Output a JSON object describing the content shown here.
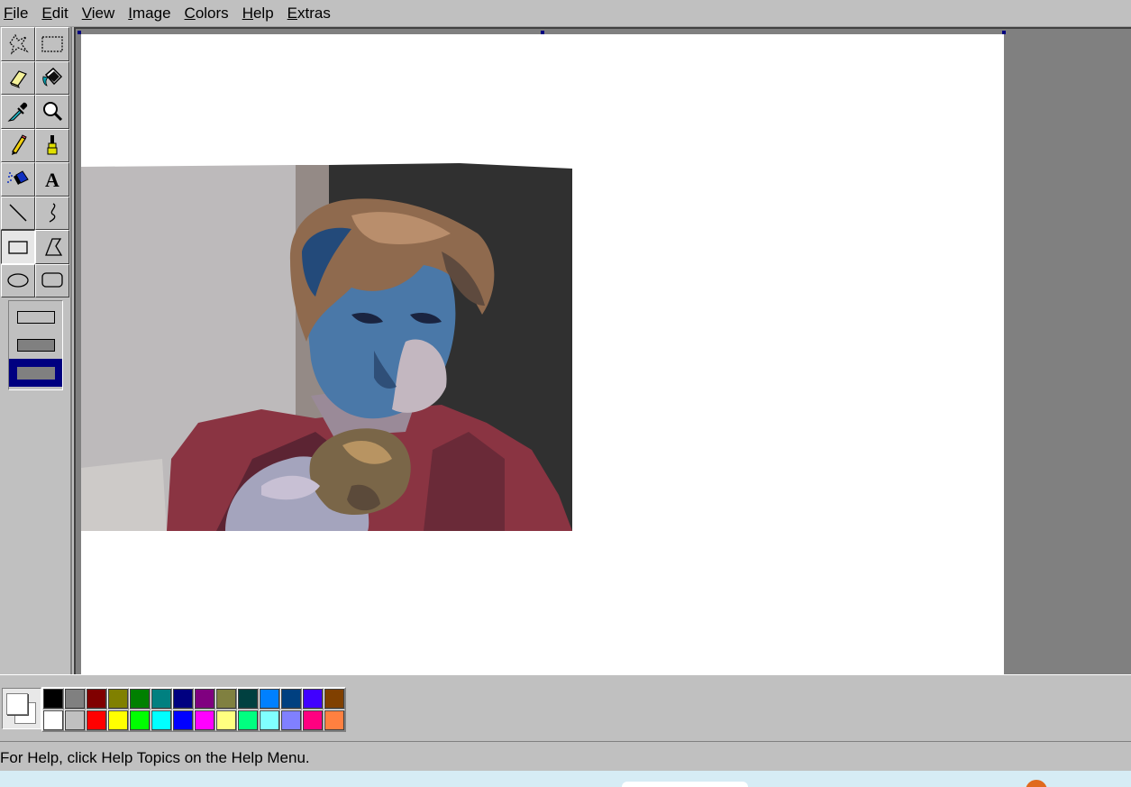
{
  "menu": [
    {
      "label": "File",
      "mnemonic": "F",
      "rest": "ile"
    },
    {
      "label": "Edit",
      "mnemonic": "E",
      "rest": "dit"
    },
    {
      "label": "View",
      "mnemonic": "V",
      "rest": "iew"
    },
    {
      "label": "Image",
      "mnemonic": "I",
      "rest": "mage"
    },
    {
      "label": "Colors",
      "mnemonic": "C",
      "rest": "olors"
    },
    {
      "label": "Help",
      "mnemonic": "H",
      "rest": "elp"
    },
    {
      "label": "Extras",
      "mnemonic": "E",
      "rest": "xtras"
    }
  ],
  "tools": [
    {
      "name": "free-form-select",
      "icon": "free-select-icon"
    },
    {
      "name": "rect-select",
      "icon": "rect-select-icon"
    },
    {
      "name": "eraser",
      "icon": "eraser-icon"
    },
    {
      "name": "fill",
      "icon": "paint-bucket-icon"
    },
    {
      "name": "pick-color",
      "icon": "eyedropper-icon"
    },
    {
      "name": "magnifier",
      "icon": "magnifier-icon"
    },
    {
      "name": "pencil",
      "icon": "pencil-icon"
    },
    {
      "name": "brush",
      "icon": "brush-icon"
    },
    {
      "name": "airbrush",
      "icon": "airbrush-icon"
    },
    {
      "name": "text",
      "icon": "text-icon",
      "glyph": "A"
    },
    {
      "name": "line",
      "icon": "line-icon"
    },
    {
      "name": "curve",
      "icon": "curve-icon"
    },
    {
      "name": "rectangle",
      "icon": "rectangle-icon",
      "active": true
    },
    {
      "name": "polygon",
      "icon": "polygon-icon"
    },
    {
      "name": "ellipse",
      "icon": "ellipse-icon"
    },
    {
      "name": "rounded-rectangle",
      "icon": "rounded-rectangle-icon"
    }
  ],
  "fill_options": [
    "outline-only",
    "outline-and-fill",
    "fill-only"
  ],
  "selected_fill_option": 2,
  "current_colors": {
    "foreground": "#ffffff",
    "background": "#ffffff"
  },
  "palette": [
    "#000000",
    "#808080",
    "#800000",
    "#808000",
    "#008000",
    "#008080",
    "#000080",
    "#800080",
    "#808040",
    "#004040",
    "#0080ff",
    "#004080",
    "#4000ff",
    "#804000",
    "#ffffff",
    "#c0c0c0",
    "#ff0000",
    "#ffff00",
    "#00ff00",
    "#00ffff",
    "#0000ff",
    "#ff00ff",
    "#ffff80",
    "#00ff80",
    "#80ffff",
    "#8080ff",
    "#ff0080",
    "#ff8040"
  ],
  "status": {
    "text": "For Help, click Help Topics on the Help Menu."
  },
  "colors": {
    "chrome": "#c0c0c0",
    "workspace": "#808080",
    "selection": "#000080"
  }
}
